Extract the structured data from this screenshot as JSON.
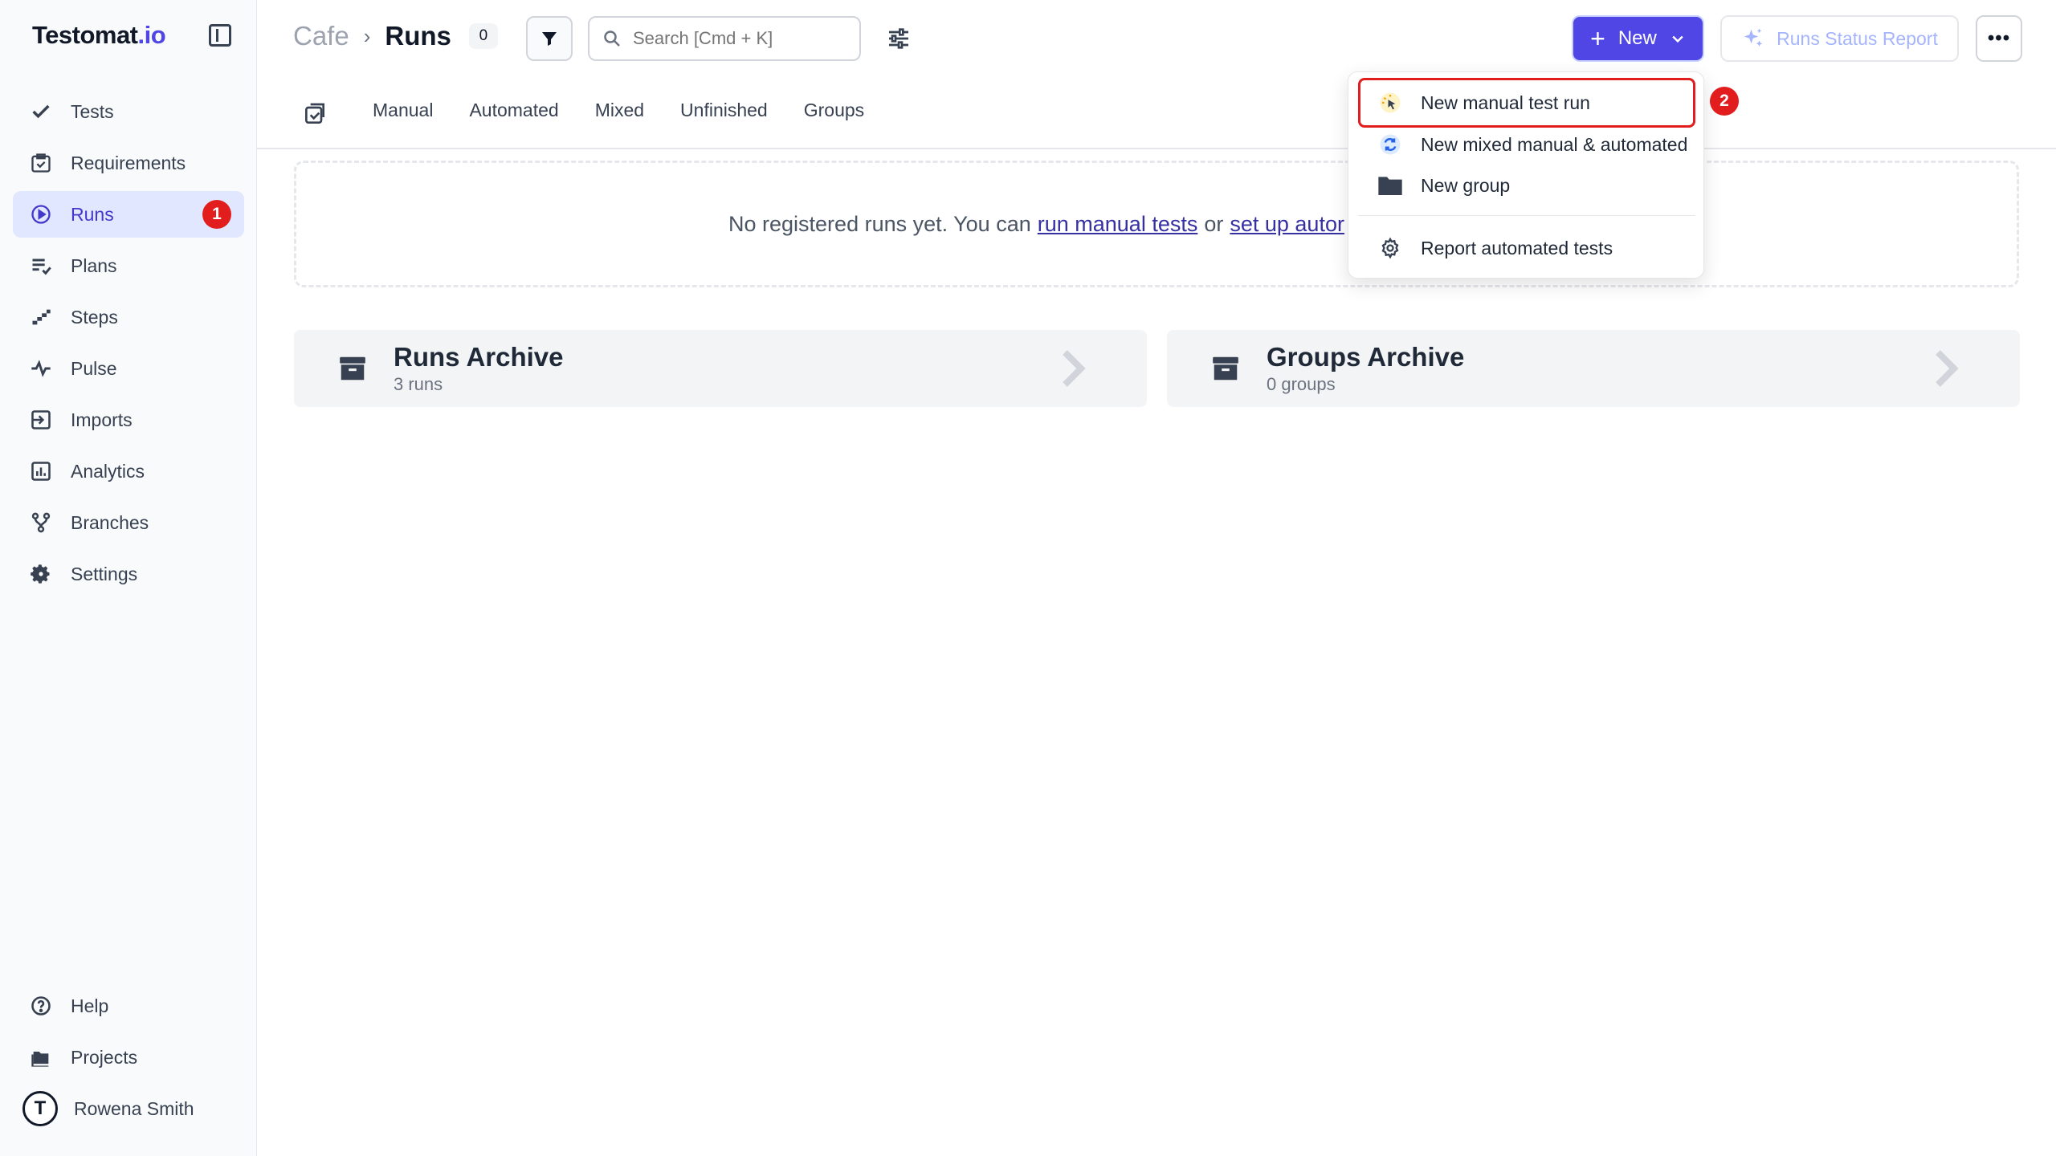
{
  "app": {
    "logo_main": "Testomat",
    "logo_suffix": ".io"
  },
  "sidebar": {
    "items": [
      {
        "label": "Tests",
        "icon": "check-icon"
      },
      {
        "label": "Requirements",
        "icon": "clipboard-check-icon"
      },
      {
        "label": "Runs",
        "icon": "play-circle-icon",
        "active": true,
        "badge": "1"
      },
      {
        "label": "Plans",
        "icon": "list-check-icon"
      },
      {
        "label": "Steps",
        "icon": "steps-icon"
      },
      {
        "label": "Pulse",
        "icon": "pulse-icon"
      },
      {
        "label": "Imports",
        "icon": "import-icon"
      },
      {
        "label": "Analytics",
        "icon": "analytics-icon"
      },
      {
        "label": "Branches",
        "icon": "branch-icon"
      },
      {
        "label": "Settings",
        "icon": "gear-icon"
      }
    ],
    "bottom": {
      "help": "Help",
      "projects": "Projects",
      "user_name": "Rowena Smith"
    }
  },
  "header": {
    "project": "Cafe",
    "separator": "›",
    "current": "Runs",
    "count": "0",
    "search_placeholder": "Search [Cmd + K]",
    "new_label": "New",
    "report_label": "Runs Status Report",
    "more_label": "•••"
  },
  "tabs": [
    "Manual",
    "Automated",
    "Mixed",
    "Unfinished",
    "Groups"
  ],
  "empty_state": {
    "prefix": "No registered runs yet. You can",
    "link1": "run manual tests",
    "middle": "or",
    "link2": "set up autor"
  },
  "archives": [
    {
      "title": "Runs Archive",
      "subtitle": "3 runs"
    },
    {
      "title": "Groups Archive",
      "subtitle": "0 groups"
    }
  ],
  "dropdown": {
    "items": [
      {
        "label": "New manual test run",
        "icon": "manual-run-icon"
      },
      {
        "label": "New mixed manual & automated",
        "icon": "mixed-run-icon"
      },
      {
        "label": "New group",
        "icon": "folder-icon"
      },
      {
        "label": "Report automated tests",
        "icon": "gear-icon"
      }
    ],
    "step_badge": "2"
  },
  "colors": {
    "accent": "#4f46e5",
    "active_bg": "#e0e7ff",
    "badge_red": "#e11d1d"
  }
}
